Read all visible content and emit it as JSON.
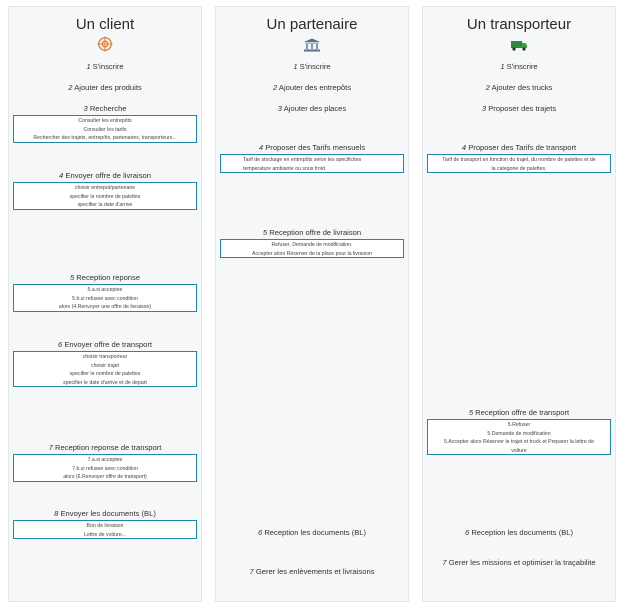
{
  "columns": [
    {
      "title": "Un client",
      "icon": "target-icon",
      "steps": [
        {
          "num": "1",
          "label": "S'inscrire"
        },
        {
          "num": "2",
          "label": "Ajouter des produits"
        },
        {
          "num": "3",
          "label": "Recherche",
          "details": [
            "Consulter les entrepôts",
            "Consulter les tarifs",
            "Rechercher des trajets, entrepôts, partenaires, transporteurs..."
          ]
        },
        {
          "num": "4",
          "label": "Envoyer offre de livraison",
          "details": [
            "choisir entrepot/partenaire",
            "specifier le nombre de palettes",
            "specifier la date d'arrive"
          ]
        },
        {
          "num": "5",
          "label": "Reception reponse",
          "details": [
            "5.a.si acceptee",
            "5.b.si refusee avec condition",
            "alors (4.Renvoyer une offre de livraison)"
          ]
        },
        {
          "num": "6",
          "label": "Envoyer offre de transport",
          "details": [
            "choisir transporteur",
            "choisir trajet",
            "specifier le nombre de palettes",
            "specifier le date d'arrive et de depart"
          ]
        },
        {
          "num": "7",
          "label": "Reception reponse de transport",
          "details": [
            "7.a.si acceptee",
            "7.b.si refusee avec condition",
            "alors (6.Renvoyer offre de transport)"
          ]
        },
        {
          "num": "8",
          "label": "Envoyer les documents (BL)",
          "details": [
            "Bon de livraison",
            "Lettre de voiture..."
          ]
        }
      ]
    },
    {
      "title": "Un partenaire",
      "icon": "bank-icon",
      "steps": [
        {
          "num": "1",
          "label": "S'inscrire"
        },
        {
          "num": "2",
          "label": "Ajouter des entrepôts"
        },
        {
          "num": "3",
          "label": "Ajouter des places"
        },
        {
          "num": "4",
          "label": "Proposer des Tarifs mensuels",
          "details": [
            "Tarif de stockage en entrepôts selon les specificites",
            "temperature ambiante ou sous froid."
          ]
        },
        {
          "num": "5",
          "label": "Reception offre de livraison",
          "details": [
            "Refuser, Demande de modification.",
            "Accepter alors Réserver de la place pour la livraison"
          ]
        },
        {
          "num": "6",
          "label": "Reception les documents (BL)"
        },
        {
          "num": "7",
          "label": "Gerer les enlèvements et livraisons"
        }
      ]
    },
    {
      "title": "Un transporteur",
      "icon": "truck-icon",
      "steps": [
        {
          "num": "1",
          "label": "S'inscrire"
        },
        {
          "num": "2",
          "label": "Ajouter des trucks"
        },
        {
          "num": "3",
          "label": "Proposer des trajets"
        },
        {
          "num": "4",
          "label": "Proposer des Tarifs de transport",
          "details": [
            "Tarif de transport en fonction du trajet, du nombre de palettes et de",
            "la categorie de palettes."
          ]
        },
        {
          "num": "5",
          "label": "Reception offre de transport",
          "details": [
            "5.Refuser",
            "5.Demande de modification",
            "5.Accepter alors Réserver le trajet et truck et Preparer la lettre de",
            "voiture"
          ]
        },
        {
          "num": "6",
          "label": "Reception les documents (BL)"
        },
        {
          "num": "7",
          "label": "Gerer les missions et optimiser la traçabilite"
        }
      ]
    }
  ]
}
